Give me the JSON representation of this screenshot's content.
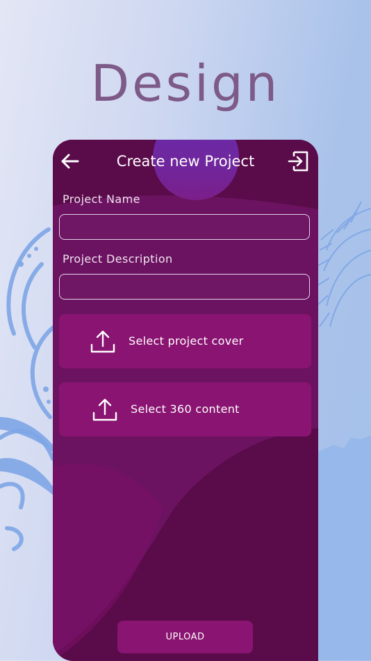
{
  "headline": "Design",
  "screen": {
    "title": "Create new Project",
    "back_icon": "arrow-left-icon",
    "exit_icon": "exit-icon",
    "fields": [
      {
        "label": "Project Name",
        "value": "",
        "placeholder": ""
      },
      {
        "label": "Project Description",
        "value": "",
        "placeholder": ""
      }
    ],
    "actions": [
      {
        "label": "Select project cover",
        "icon": "upload-icon"
      },
      {
        "label": "Select 360 content",
        "icon": "upload-icon"
      }
    ],
    "upload_label": "UPLOAD"
  },
  "colors": {
    "background": "#c8d4f0",
    "headline": "#7d5a88",
    "screen_background": "#5a0b4a",
    "button": "#8a1471",
    "accent_circle": "#6a2aa6"
  }
}
